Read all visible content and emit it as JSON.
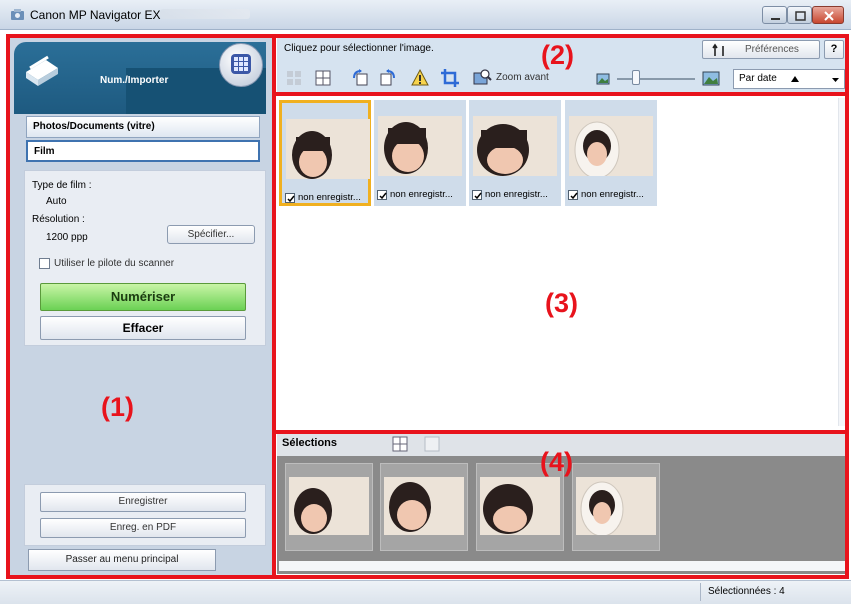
{
  "window": {
    "title": "Canon MP Navigator EX"
  },
  "left_panel": {
    "mode_label": "Num./Importer",
    "source_photos": "Photos/Documents (vitre)",
    "source_film": "Film",
    "film_type_label": "Type de film :",
    "film_type_value": "Auto",
    "resolution_label": "Résolution :",
    "resolution_value": "1200 ppp",
    "specify_button": "Spécifier...",
    "use_driver_label": "Utiliser le pilote du scanner",
    "scan_button": "Numériser",
    "clear_button": "Effacer",
    "save_button": "Enregistrer",
    "save_pdf_button": "Enreg. en PDF",
    "main_menu_button": "Passer au menu principal"
  },
  "toolbar": {
    "hint": "Cliquez pour sélectionner l'image.",
    "preferences_button": "Préférences",
    "help_button": "?",
    "zoom_label": "Zoom avant",
    "sort_value": "Par date",
    "tools": [
      "select-all-icon",
      "grid-icon",
      "rotate-left-icon",
      "rotate-right-icon",
      "warning-icon",
      "crop-icon",
      "photo-zoom-icon"
    ]
  },
  "thumbnails": [
    {
      "caption": "non enregistr...",
      "checked": true,
      "selected": true
    },
    {
      "caption": "non enregistr...",
      "checked": true,
      "selected": false
    },
    {
      "caption": "non enregistr...",
      "checked": true,
      "selected": false
    },
    {
      "caption": "non enregistr...",
      "checked": true,
      "selected": false
    }
  ],
  "selections": {
    "title": "Sélections",
    "count": 4
  },
  "status": {
    "text": "Sélectionnées : 4"
  },
  "annotations": {
    "a1": "(1)",
    "a2": "(2)",
    "a3": "(3)",
    "a4": "(4)"
  },
  "colors": {
    "annotation_red": "#e8131c",
    "header_blue": "#1e5a80",
    "scan_green": "#6bd154",
    "selection_orange": "#f0b020"
  }
}
